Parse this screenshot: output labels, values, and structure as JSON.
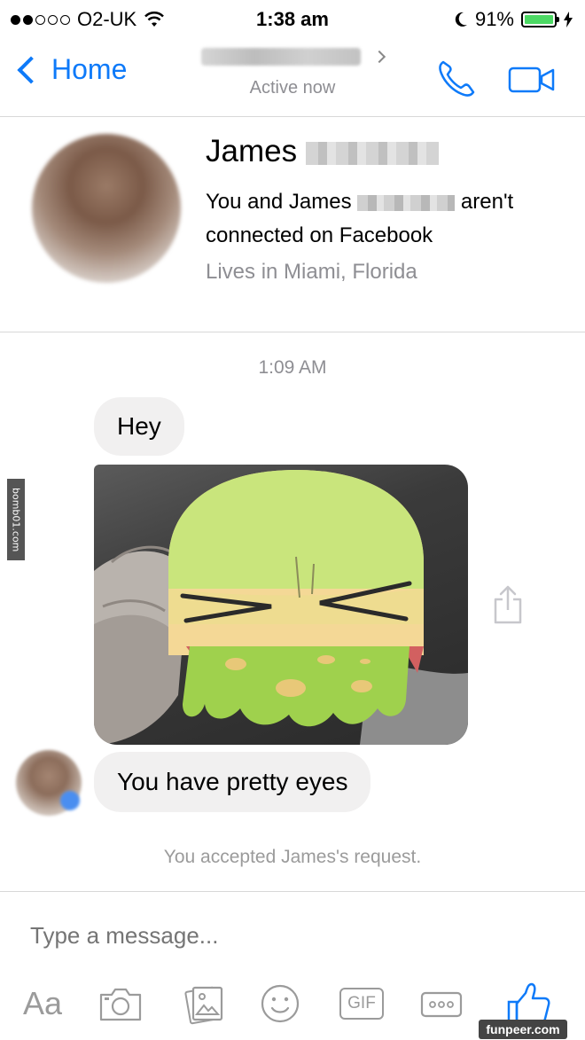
{
  "status_bar": {
    "carrier": "O2-UK",
    "time": "1:38 am",
    "battery": "91%",
    "battery_level": 0.91
  },
  "nav": {
    "back_label": "Home",
    "subtitle": "Active now"
  },
  "profile": {
    "first_name": "James",
    "connection_pre": "You and James",
    "connection_post": "aren't connected on Facebook",
    "location": "Lives in Miami, Florida"
  },
  "conversation": {
    "timestamp": "1:09 AM",
    "message_1": "Hey",
    "message_2": "You have pretty eyes",
    "system_note": "You accepted James's request."
  },
  "composer": {
    "placeholder": "Type a message...",
    "aa_label": "Aa",
    "gif_label": "GIF"
  },
  "watermarks": {
    "side": "bomb01.com",
    "bottom": "funpeer.com"
  },
  "colors": {
    "accent": "#0e7af9",
    "bubble": "#f1f0f0",
    "muted": "#8e8e93"
  }
}
